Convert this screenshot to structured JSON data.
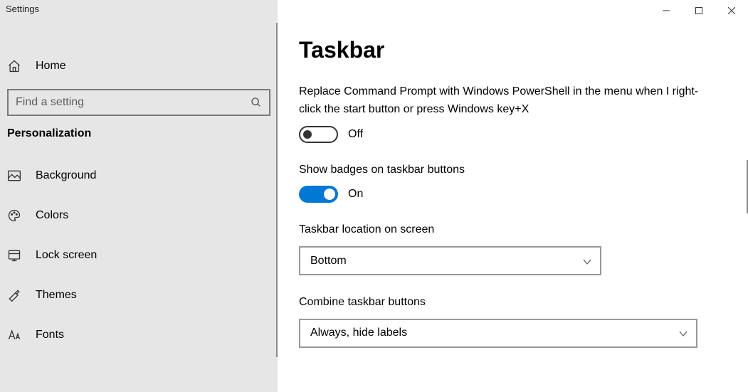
{
  "window": {
    "title": "Settings"
  },
  "sidebar": {
    "home_label": "Home",
    "search_placeholder": "Find a setting",
    "category": "Personalization",
    "items": [
      {
        "label": "Background"
      },
      {
        "label": "Colors"
      },
      {
        "label": "Lock screen"
      },
      {
        "label": "Themes"
      },
      {
        "label": "Fonts"
      }
    ]
  },
  "page": {
    "title": "Taskbar",
    "setting1": {
      "label": "Replace Command Prompt with Windows PowerShell in the menu when I right-click the start button or press Windows key+X",
      "state": "Off"
    },
    "setting2": {
      "label": "Show badges on taskbar buttons",
      "state": "On"
    },
    "setting3": {
      "label": "Taskbar location on screen",
      "value": "Bottom"
    },
    "setting4": {
      "label": "Combine taskbar buttons",
      "value": "Always, hide labels"
    }
  }
}
